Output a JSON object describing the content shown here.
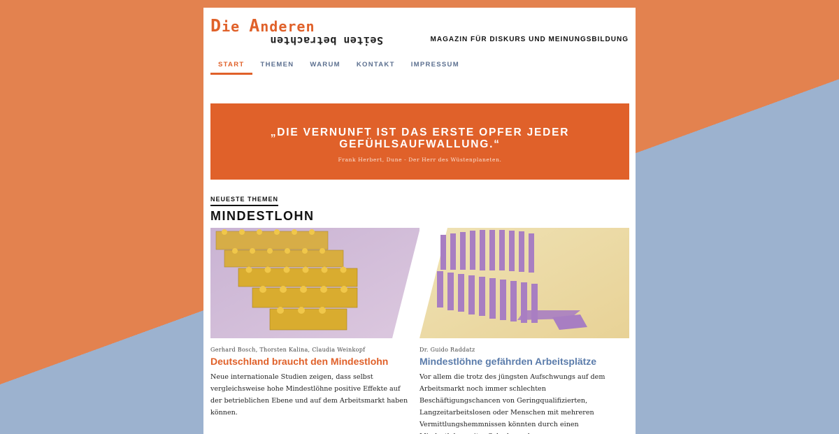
{
  "header": {
    "logo_first": "D",
    "logo_first_rest": "ie ",
    "logo_second": "A",
    "logo_second_rest": "nderen",
    "logo_sub": "Seiten betrachten",
    "tagline": "MAGAZIN FÜR DISKURS UND MEINUNGSBILDUNG"
  },
  "nav": [
    "START",
    "THEMEN",
    "WARUM",
    "KONTAKT",
    "IMPRESSUM"
  ],
  "quote": {
    "text": "„DIE VERNUNFT IST DAS ERSTE OPFER JEDER GEFÜHLSAUFWALLUNG.“",
    "source": "Frank Herbert, Dune - Der Herr des Wüstenplaneten."
  },
  "section": {
    "label": "NEUESTE THEMEN",
    "title": "MINDESTLOHN"
  },
  "articles": [
    {
      "authors": "Gerhard Bosch, Thorsten Kalina, Claudia Weinkopf",
      "title": "Deutschland braucht den Mindestlohn",
      "excerpt": "Neue internationale Studien zeigen, dass selbst vergleichsweise hohe Mindestlöhne positive Effekte auf der betrieblichen Ebene und auf dem Arbeitsmarkt haben können."
    },
    {
      "authors": "Dr. Guido Raddatz",
      "title": "Mindestlöhne gefährden Arbeitsplätze",
      "excerpt": "Vor allem die trotz des jüngsten Aufschwungs auf dem Arbeitsmarkt noch immer schlechten Beschäftigungschancen von Geringqualifizierten, Langzeitarbeitslosen oder Menschen mit mehreren Vermittlungshemmnissen könnten durch einen Mindestlohn weiter Schaden nehmen."
    }
  ],
  "colors": {
    "accent": "#e0612a",
    "secondary": "#5b7cab",
    "bg_orange": "#e3824f",
    "bg_blue": "#9cb2cf"
  }
}
